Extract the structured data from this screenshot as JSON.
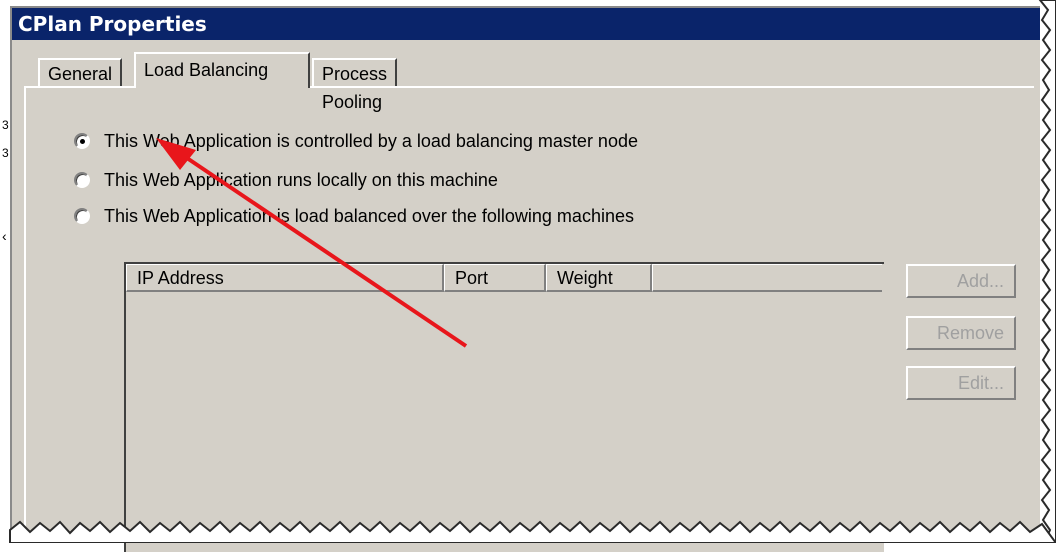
{
  "window": {
    "title": "CPlan Properties"
  },
  "tabs": [
    {
      "label": "General",
      "active": false
    },
    {
      "label": "Load Balancing",
      "active": true
    },
    {
      "label": "Process Pooling",
      "active": false
    }
  ],
  "edge_fragments": [
    "3",
    "3"
  ],
  "options": [
    {
      "label": "This Web Application is controlled by a load balancing master node",
      "checked": true
    },
    {
      "label": "This Web Application runs locally on this machine",
      "checked": false
    },
    {
      "label": "This Web Application is load balanced over the following machines",
      "checked": false
    }
  ],
  "machines_table": {
    "columns": [
      "IP Address",
      "Port",
      "Weight"
    ],
    "rows": []
  },
  "buttons": {
    "add": "Add...",
    "remove": "Remove",
    "edit": "Edit..."
  },
  "colors": {
    "titlebar": "#0a246a",
    "dialog_bg": "#d4d0c8",
    "annotation_arrow": "#e8161b"
  },
  "annotation": {
    "type": "arrow",
    "points_to": "options.0"
  }
}
